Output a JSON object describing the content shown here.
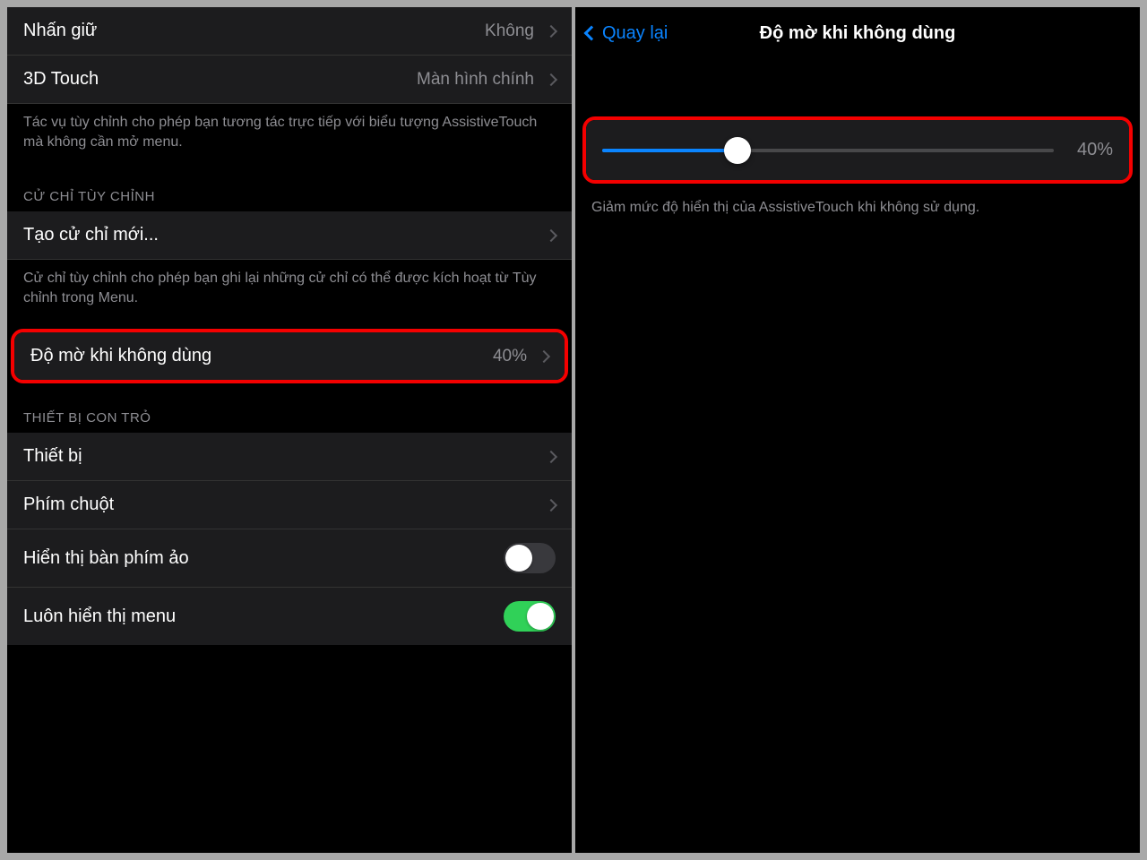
{
  "left": {
    "rows": {
      "press_hold": {
        "label": "Nhấn giữ",
        "value": "Không"
      },
      "touch3d": {
        "label": "3D Touch",
        "value": "Màn hình chính"
      }
    },
    "top_footer": "Tác vụ tùy chỉnh cho phép bạn tương tác trực tiếp với biểu tượng AssistiveTouch mà không cần mở menu.",
    "custom_gestures_header": "CỬ CHỈ TÙY CHỈNH",
    "create_gesture": "Tạo cử chỉ mới...",
    "custom_gestures_footer": "Cử chỉ tùy chỉnh cho phép bạn ghi lại những cử chỉ có thể được kích hoạt từ Tùy chỉnh trong Menu.",
    "idle_opacity": {
      "label": "Độ mờ khi không dùng",
      "value": "40%"
    },
    "pointer_header": "THIẾT BỊ CON TRỎ",
    "devices": "Thiết bị",
    "mouse_keys": "Phím chuột",
    "show_keyboard": {
      "label": "Hiển thị bàn phím ảo",
      "on": false
    },
    "always_menu": {
      "label": "Luôn hiển thị menu",
      "on": true
    }
  },
  "right": {
    "back": "Quay lại",
    "title": "Độ mờ khi không dùng",
    "slider": {
      "percent": 30,
      "value_label": "40%"
    },
    "footer": "Giảm mức độ hiển thị của AssistiveTouch khi không sử dụng."
  }
}
